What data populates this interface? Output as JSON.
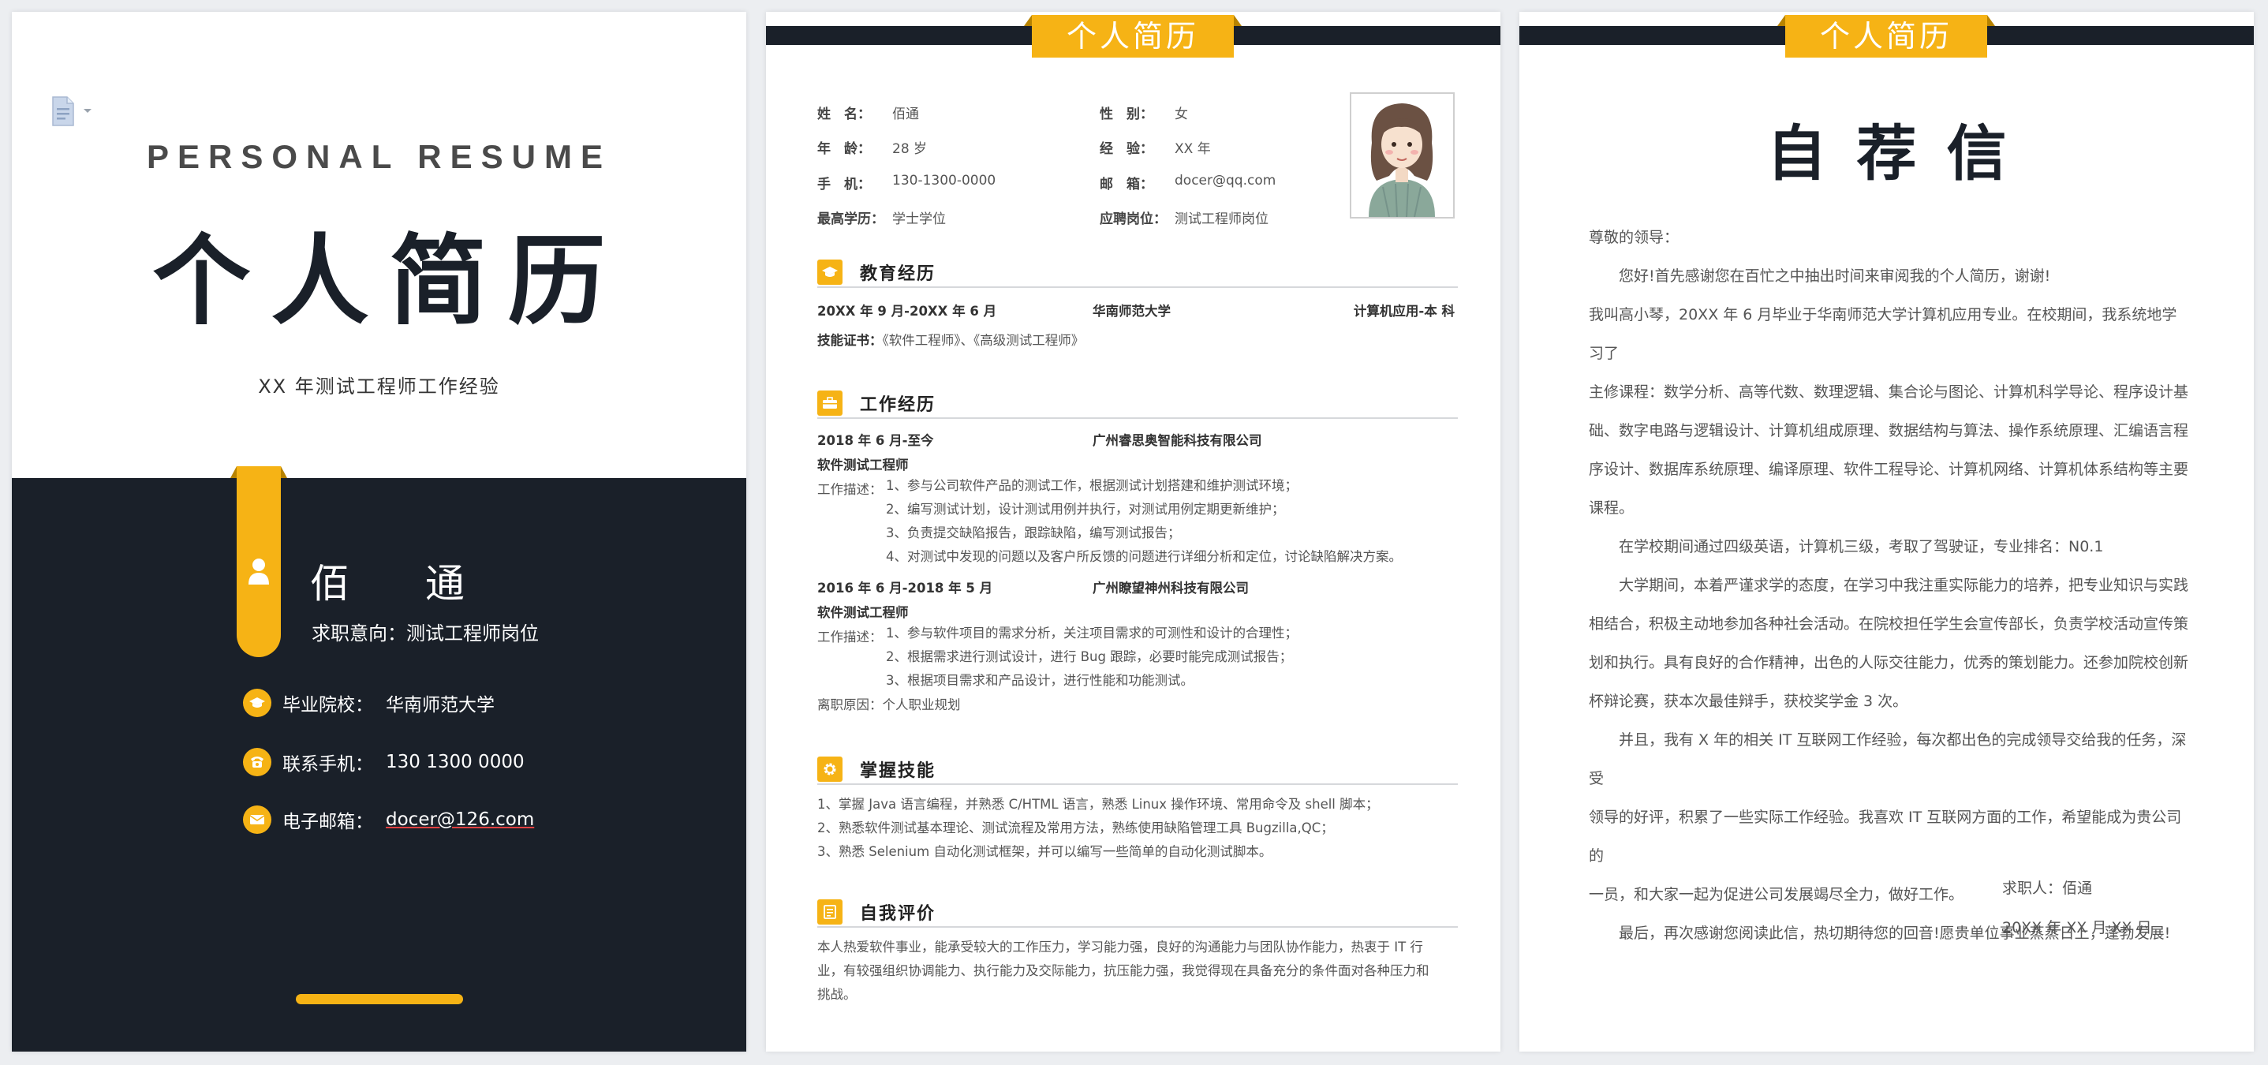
{
  "cover": {
    "en_title": "PERSONAL RESUME",
    "cn_title": "个人简历",
    "subtitle": "XX 年测试工程师工作经验",
    "name": "佰 通",
    "intent_label": "求职意向：",
    "intent_value": "测试工程师岗位",
    "rows": [
      {
        "label": "毕业院校：",
        "value": "华南师范大学"
      },
      {
        "label": "联系手机：",
        "value": "130 1300 0000"
      },
      {
        "label": "电子邮箱：",
        "value": "docer@126.com"
      }
    ]
  },
  "resume": {
    "header": "个人简历",
    "info": [
      {
        "k": "姓　名：",
        "v": "佰通",
        "k2": "性　别：",
        "v2": "女"
      },
      {
        "k": "年　龄：",
        "v": "28 岁",
        "k2": "经　验：",
        "v2": "XX 年"
      },
      {
        "k": "手　机：",
        "v": "130-1300-0000",
        "k2": "邮　箱：",
        "v2": "docer@qq.com"
      },
      {
        "k": "最高学历：",
        "v": "学士学位",
        "k2": "应聘岗位：",
        "v2": "测试工程师岗位"
      }
    ],
    "education": {
      "title": "教育经历",
      "period": "20XX 年 9 月-20XX 年 6 月",
      "school": "华南师范大学",
      "major": "计算机应用-本 科",
      "cert_label": "技能证书：",
      "cert_value": "《软件工程师》、《高级测试工程师》"
    },
    "work": {
      "title": "工作经历",
      "jobs": [
        {
          "period": "2018 年 6 月-至今",
          "company": "广州睿思奥智能科技有限公司",
          "position": "软件测试工程师",
          "desc_label": "工作描述：",
          "items": [
            "1、参与公司软件产品的测试工作，根据测试计划搭建和维护测试环境；",
            "2、编写测试计划，设计测试用例并执行，对测试用例定期更新维护；",
            "3、负责提交缺陷报告，跟踪缺陷，编写测试报告；",
            "4、对测试中发现的问题以及客户所反馈的问题进行详细分析和定位，讨论缺陷解决方案。"
          ]
        },
        {
          "period": "2016 年 6 月-2018 年 5 月",
          "company": "广州瞭望神州科技有限公司",
          "position": "软件测试工程师",
          "desc_label": "工作描述：",
          "items": [
            "1、参与软件项目的需求分析，关注项目需求的可测性和设计的合理性；",
            "2、根据需求进行测试设计，进行 Bug 跟踪，必要时能完成测试报告；",
            "3、根据项目需求和产品设计，进行性能和功能测试。"
          ],
          "leave_label": "离职原因：",
          "leave_value": "个人职业规划"
        }
      ]
    },
    "skills": {
      "title": "掌握技能",
      "items": [
        "1、掌握 Java 语言编程，并熟悉 C/HTML 语言，熟悉 Linux 操作环境、常用命令及 shell 脚本；",
        "2、熟悉软件测试基本理论、测试流程及常用方法，熟练使用缺陷管理工具 Bugzilla,QC；",
        "3、熟悉 Selenium 自动化测试框架，并可以编写一些简单的自动化测试脚本。"
      ]
    },
    "self": {
      "title": "自我评价",
      "lines": [
        "本人热爱软件事业，能承受较大的工作压力，学习能力强，良好的沟通能力与团队协作能力，热衷于 IT 行",
        "业，有较强组织协调能力、执行能力及交际能力，抗压能力强，我觉得现在具备充分的条件面对各种压力和",
        "挑战。"
      ]
    }
  },
  "letter": {
    "header": "个人简历",
    "title": "自荐信",
    "greeting": "尊敬的领导：",
    "lines": [
      {
        "t": "您好!首先感谢您在百忙之中抽出时间来审阅我的个人简历，谢谢!",
        "indent": true
      },
      {
        "t": "我叫高小琴，20XX 年 6 月毕业于华南师范大学计算机应用专业。在校期间，我系统地学习了",
        "indent": false
      },
      {
        "t": "主修课程：数学分析、高等代数、数理逻辑、集合论与图论、计算机科学导论、程序设计基",
        "indent": false
      },
      {
        "t": "础、数字电路与逻辑设计、计算机组成原理、数据结构与算法、操作系统原理、汇编语言程",
        "indent": false
      },
      {
        "t": "序设计、数据库系统原理、编译原理、软件工程导论、计算机网络、计算机体系结构等主要",
        "indent": false
      },
      {
        "t": "课程。",
        "indent": false
      },
      {
        "t": "在学校期间通过四级英语，计算机三级，考取了驾驶证，专业排名：N0.1",
        "indent": true
      },
      {
        "t": "大学期间，本着严谨求学的态度，在学习中我注重实际能力的培养，把专业知识与实践",
        "indent": true
      },
      {
        "t": "相结合，积极主动地参加各种社会活动。在院校担任学生会宣传部长，负责学校活动宣传策",
        "indent": false
      },
      {
        "t": "划和执行。具有良好的合作精神，出色的人际交往能力，优秀的策划能力。还参加院校创新",
        "indent": false
      },
      {
        "t": "杯辩论赛，获本次最佳辩手，获校奖学金 3 次。",
        "indent": false
      },
      {
        "t": "并且，我有 X 年的相关 IT 互联网工作经验，每次都出色的完成领导交给我的任务，深受",
        "indent": true
      },
      {
        "t": "领导的好评，积累了一些实际工作经验。我喜欢 IT 互联网方面的工作，希望能成为贵公司的",
        "indent": false
      },
      {
        "t": "一员，和大家一起为促进公司发展竭尽全力，做好工作。",
        "indent": false
      },
      {
        "t": "最后，再次感谢您阅读此信，热切期待您的回音!愿贵单位事业蒸蒸日上，蓬勃发展!",
        "indent": true
      }
    ],
    "sign_name": "求职人：佰通",
    "sign_date": "20XX 年 XX 月 XX 日"
  },
  "colors": {
    "accent": "#f6b315",
    "dark": "#1a2029"
  }
}
